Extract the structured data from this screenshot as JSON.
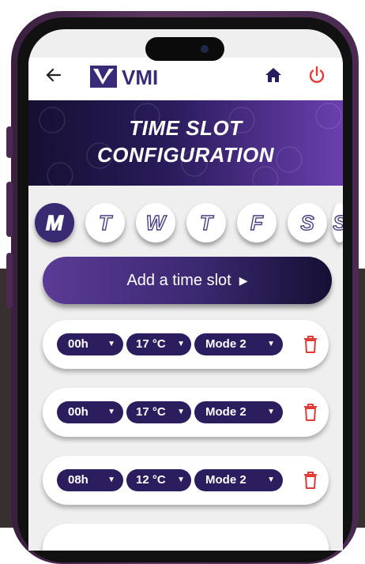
{
  "app": {
    "logo_text": "VMI",
    "title_line1": "TIME SLOT",
    "title_line2": "CONFIGURATION"
  },
  "header": {
    "back_icon": "arrow-left-icon",
    "home_icon": "home-icon",
    "power_icon": "power-icon"
  },
  "days": [
    {
      "label": "M",
      "active": true
    },
    {
      "label": "T",
      "active": false
    },
    {
      "label": "W",
      "active": false
    },
    {
      "label": "T",
      "active": false
    },
    {
      "label": "F",
      "active": false
    },
    {
      "label": "S",
      "active": false
    },
    {
      "label": "S",
      "active": false
    }
  ],
  "add_slot": {
    "label": "Add a time slot",
    "icon": "caret-right-icon"
  },
  "slots": [
    {
      "hour": "00h",
      "temperature": "17 °C",
      "mode": "Mode 2"
    },
    {
      "hour": "00h",
      "temperature": "17 °C",
      "mode": "Mode 2"
    },
    {
      "hour": "08h",
      "temperature": "12 °C",
      "mode": "Mode 2"
    }
  ],
  "colors": {
    "primary": "#2c1d5e",
    "accent": "#6a3fae",
    "danger": "#e53935"
  }
}
